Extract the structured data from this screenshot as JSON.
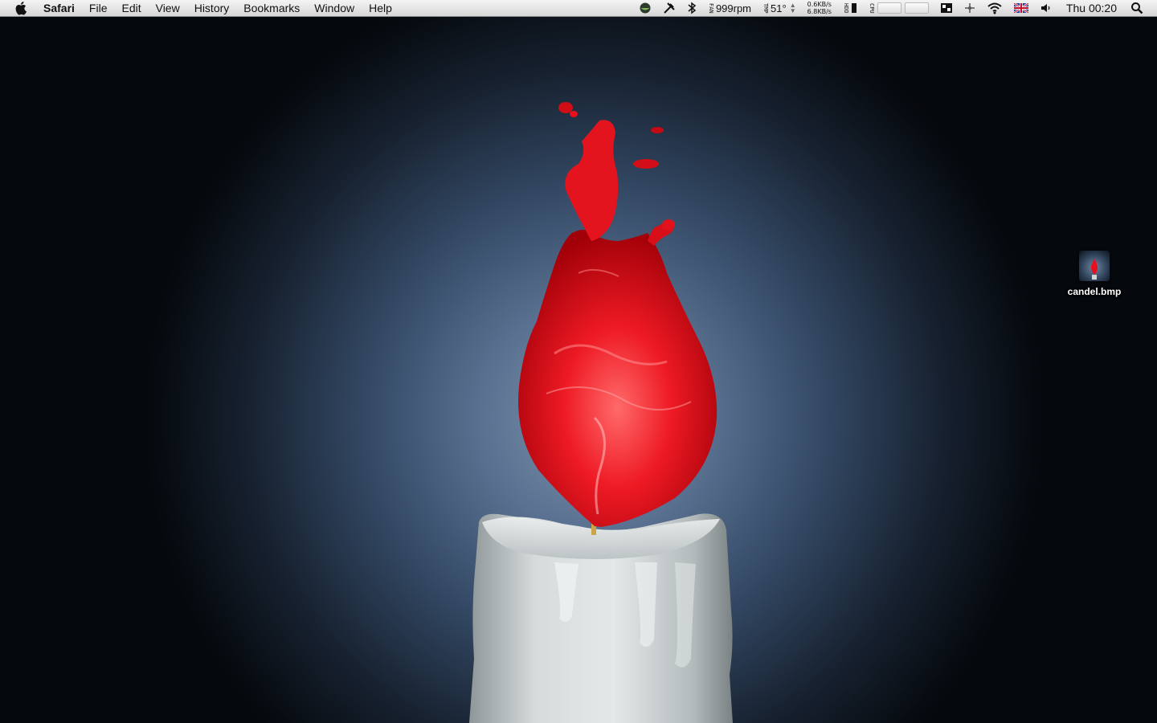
{
  "menubar": {
    "app_name": "Safari",
    "menus": [
      "File",
      "Edit",
      "View",
      "History",
      "Bookmarks",
      "Window",
      "Help"
    ],
    "status": {
      "fan_label": "FAN",
      "fan_speed": "999rpm",
      "temp_label": "TMP",
      "temperature": "51°",
      "net_up": "0.6KB/s",
      "net_down": "6.8KB/s",
      "disk_label": "HDD",
      "cpu_label": "CPU",
      "clock": "Thu 00:20"
    },
    "icons": [
      "apple-icon",
      "eye-icon",
      "tools-icon",
      "bluetooth-icon",
      "battery-icon",
      "dual-display-icon",
      "move-icon",
      "wifi-icon",
      "uk-flag-icon",
      "volume-icon",
      "spotlight-icon"
    ]
  },
  "desktop": {
    "file_icon_label": "candel.bmp"
  },
  "colors": {
    "flame": "#e8101c",
    "wax": "#d8dcdc",
    "background_center": "#7d93ad",
    "background_edge": "#05080c"
  }
}
